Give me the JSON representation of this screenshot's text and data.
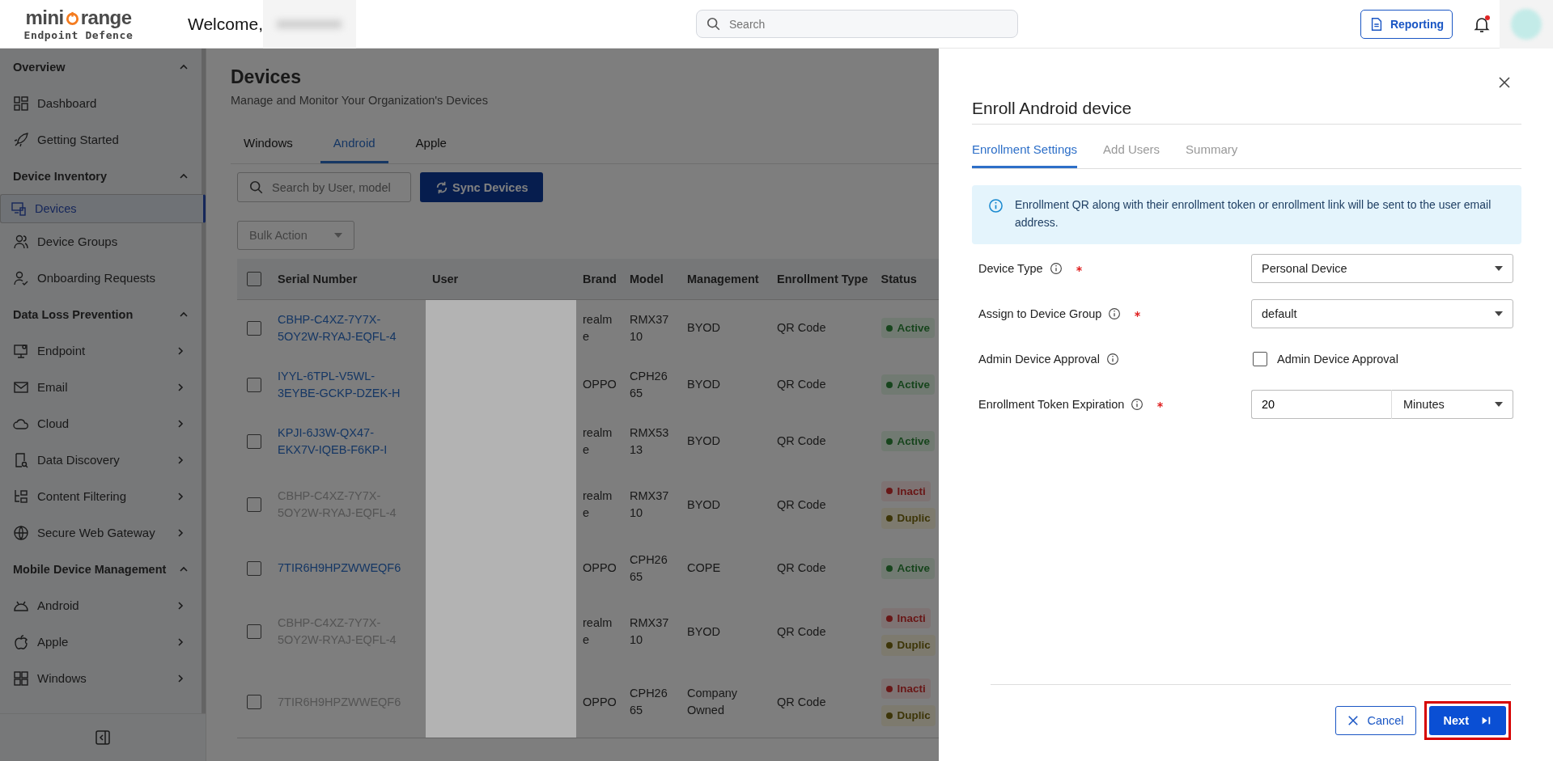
{
  "header": {
    "logo": {
      "prefix": "mini",
      "suffix": "range",
      "tagline": "Endpoint Defence"
    },
    "welcome": "Welcome,",
    "search": {
      "placeholder": "Search"
    },
    "reporting_button": "Reporting",
    "notifications": {
      "unread": true
    }
  },
  "sidebar": {
    "sections": [
      {
        "title": "Overview",
        "expanded": true,
        "items": [
          {
            "label": "Dashboard",
            "selected": false,
            "has_submenu": false
          },
          {
            "label": "Getting Started",
            "selected": false,
            "has_submenu": false
          }
        ]
      },
      {
        "title": "Device Inventory",
        "expanded": true,
        "items": [
          {
            "label": "Devices",
            "selected": true,
            "has_submenu": false
          },
          {
            "label": "Device Groups",
            "selected": false,
            "has_submenu": false
          },
          {
            "label": "Onboarding Requests",
            "selected": false,
            "has_submenu": false
          }
        ]
      },
      {
        "title": "Data Loss Prevention",
        "expanded": true,
        "items": [
          {
            "label": "Endpoint",
            "selected": false,
            "has_submenu": true
          },
          {
            "label": "Email",
            "selected": false,
            "has_submenu": true
          },
          {
            "label": "Cloud",
            "selected": false,
            "has_submenu": true
          },
          {
            "label": "Data Discovery",
            "selected": false,
            "has_submenu": true
          },
          {
            "label": "Content Filtering",
            "selected": false,
            "has_submenu": true
          },
          {
            "label": "Secure Web Gateway",
            "selected": false,
            "has_submenu": true
          }
        ]
      },
      {
        "title": "Mobile Device Management",
        "expanded": true,
        "items": [
          {
            "label": "Android",
            "selected": false,
            "has_submenu": true
          },
          {
            "label": "Apple",
            "selected": false,
            "has_submenu": true
          },
          {
            "label": "Windows",
            "selected": false,
            "has_submenu": true
          }
        ]
      }
    ]
  },
  "page": {
    "title": "Devices",
    "subtitle": "Manage and Monitor Your Organization's Devices",
    "tabs": [
      {
        "label": "Windows",
        "selected": false
      },
      {
        "label": "Android",
        "selected": true
      },
      {
        "label": "Apple",
        "selected": false
      }
    ],
    "search": {
      "placeholder": "Search by User, model"
    },
    "sync_button": "Sync Devices",
    "bulk_action": {
      "placeholder": "Bulk Action"
    },
    "table": {
      "all_checked": false,
      "columns": [
        "Serial Number",
        "User",
        "Brand",
        "Model",
        "Management",
        "Enrollment Type",
        "Status"
      ],
      "rows": [
        {
          "checked": false,
          "serial": "CBHP-C4XZ-7Y7X-5OY2W-RYAJ-EQFL-4",
          "linked": true,
          "brand": "realme",
          "model": "RMX3710",
          "management": "BYOD",
          "enrollment_type": "QR Code",
          "statuses": [
            {
              "label": "Active",
              "kind": "active"
            }
          ]
        },
        {
          "checked": false,
          "serial": "IYYL-6TPL-V5WL-3EYBE-GCKP-DZEK-H",
          "linked": true,
          "brand": "OPPO",
          "model": "CPH2665",
          "management": "BYOD",
          "enrollment_type": "QR Code",
          "statuses": [
            {
              "label": "Active",
              "kind": "active"
            }
          ]
        },
        {
          "checked": false,
          "serial": "KPJI-6J3W-QX47-EKX7V-IQEB-F6KP-I",
          "linked": true,
          "brand": "realme",
          "model": "RMX5313",
          "management": "BYOD",
          "enrollment_type": "QR Code",
          "statuses": [
            {
              "label": "Active",
              "kind": "active"
            }
          ]
        },
        {
          "checked": false,
          "serial": "CBHP-C4XZ-7Y7X-5OY2W-RYAJ-EQFL-4",
          "linked": false,
          "brand": "realme",
          "model": "RMX3710",
          "management": "BYOD",
          "enrollment_type": "QR Code",
          "statuses": [
            {
              "label": "Inacti",
              "kind": "inactive"
            },
            {
              "label": "Duplic",
              "kind": "duplicate"
            }
          ]
        },
        {
          "checked": false,
          "serial": "7TIR6H9HPZWWEQF6",
          "linked": true,
          "brand": "OPPO",
          "model": "CPH2665",
          "management": "COPE",
          "enrollment_type": "QR Code",
          "statuses": [
            {
              "label": "Active",
              "kind": "active"
            }
          ]
        },
        {
          "checked": false,
          "serial": "CBHP-C4XZ-7Y7X-5OY2W-RYAJ-EQFL-4",
          "linked": false,
          "brand": "realme",
          "model": "RMX3710",
          "management": "BYOD",
          "enrollment_type": "QR Code",
          "statuses": [
            {
              "label": "Inacti",
              "kind": "inactive"
            },
            {
              "label": "Duplic",
              "kind": "duplicate"
            }
          ]
        },
        {
          "checked": false,
          "serial": "7TIR6H9HPZWWEQF6",
          "linked": false,
          "brand": "OPPO",
          "model": "CPH2665",
          "management": "Company Owned",
          "enrollment_type": "QR Code",
          "statuses": [
            {
              "label": "Inacti",
              "kind": "inactive"
            },
            {
              "label": "Duplic",
              "kind": "duplicate"
            }
          ]
        }
      ]
    }
  },
  "drawer": {
    "title": "Enroll Android device",
    "tabs": [
      {
        "label": "Enrollment Settings",
        "selected": true
      },
      {
        "label": "Add Users",
        "selected": false
      },
      {
        "label": "Summary",
        "selected": false
      }
    ],
    "info": "Enrollment QR along with their enrollment token or enrollment link will be sent to the user email address.",
    "fields": [
      {
        "kind": "select",
        "label": "Device Type",
        "required": true,
        "value": "Personal Device"
      },
      {
        "kind": "select",
        "label": "Assign to Device Group",
        "required": true,
        "value": "default"
      },
      {
        "kind": "checkbox",
        "label": "Admin Device Approval",
        "required": false,
        "option": "Admin Device Approval",
        "checked": false
      },
      {
        "kind": "duration",
        "label": "Enrollment Token Expiration",
        "required": true,
        "value": "20",
        "unit": "Minutes"
      }
    ],
    "cancel_button": "Cancel",
    "next_button": {
      "label": "Next",
      "highlighted": true
    }
  }
}
